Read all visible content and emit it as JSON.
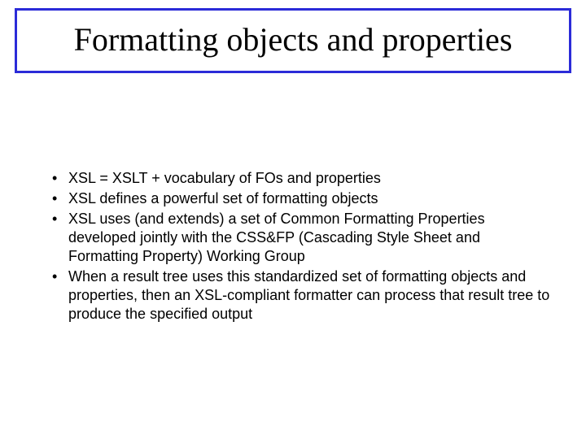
{
  "title": "Formatting objects and properties",
  "bullets": [
    "XSL = XSLT + vocabulary of FOs and properties",
    "XSL defines a powerful set of formatting objects",
    "XSL uses (and extends) a set of Common Formatting Properties developed jointly with the CSS&FP (Cascading Style Sheet and Formatting Property) Working Group",
    "When a result tree uses this standardized set of formatting objects and properties, then an XSL-compliant formatter can process that result tree to produce the specified output"
  ]
}
